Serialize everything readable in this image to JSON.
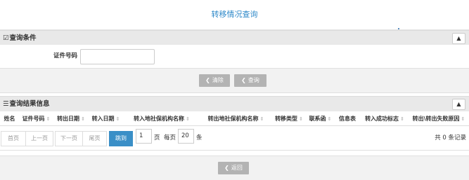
{
  "page_title": "转移情况查询",
  "query_panel": {
    "icon": "edit-icon",
    "title": "查询条件",
    "collapse_glyph": "▲",
    "field_label": "证件号码",
    "field_value": ""
  },
  "buttons": {
    "clear_label": "清除",
    "search_label": "查询",
    "back_label": "返回",
    "chevron_glyph": "❮"
  },
  "results_panel": {
    "icon": "list-icon",
    "title": "查询结果信息",
    "collapse_glyph": "▲"
  },
  "table": {
    "sort_glyph": "⇕",
    "columns": [
      "姓名",
      "证件号码",
      "转出日期",
      "转入日期",
      "转入地社保机构名称",
      "转出地社保机构名称",
      "转移类型",
      "联系函",
      "信息表",
      "转入成功标志",
      "转出\\转出失败原因"
    ]
  },
  "pager": {
    "first": "首页",
    "prev": "上一页",
    "next": "下一页",
    "last": "尾页",
    "go": "跳到",
    "page_value": "1",
    "page_unit": "页",
    "per_page_label": "每页",
    "per_page_value": "20",
    "per_page_unit": "条",
    "total": "共 0 条记录"
  },
  "colors": {
    "accent": "#2e89c9",
    "button_gray": "#b3b3b3",
    "go_button": "#3a8fc7"
  }
}
